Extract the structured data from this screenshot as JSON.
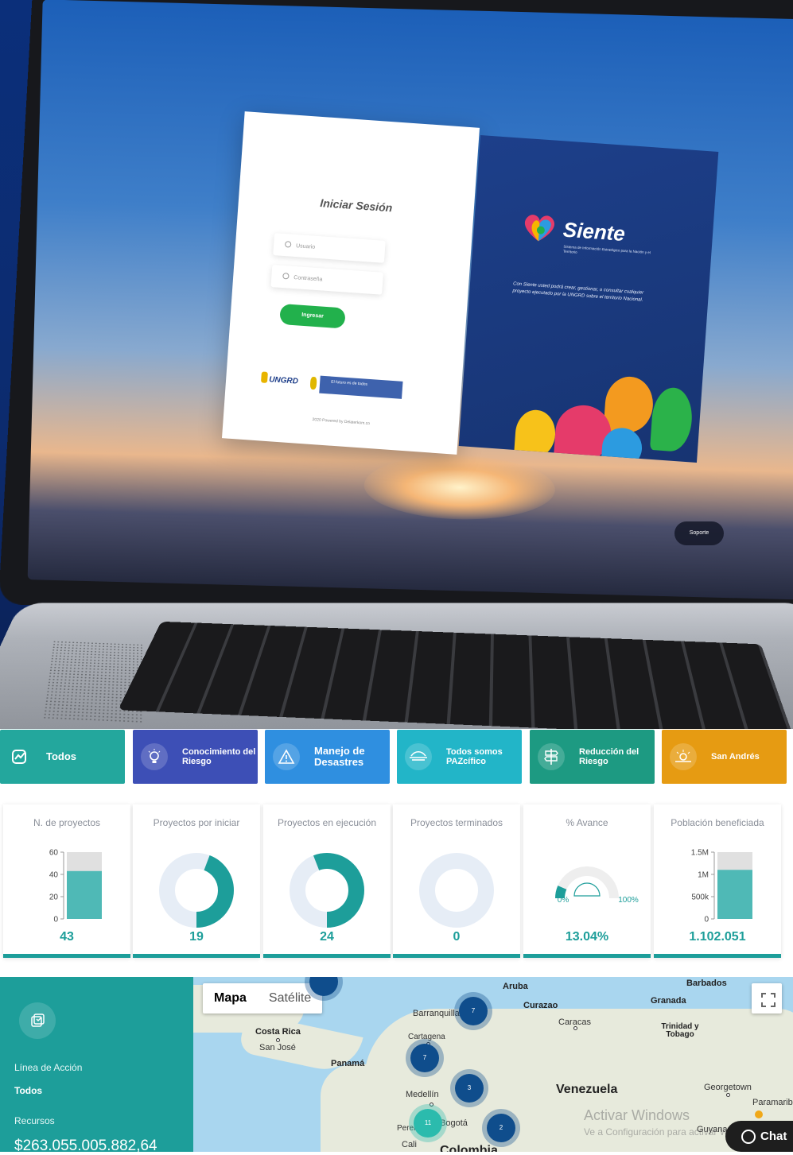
{
  "hero": {
    "login": {
      "title": "Iniciar Sesión",
      "username_placeholder": "Usuario",
      "password_placeholder": "Contraseña",
      "submit_label": "Ingresar",
      "logo_text": "UNGRD",
      "gov_logo_text": "El futuro es de todos",
      "powered_by": "2020 Powered by Delaterkom.co"
    },
    "brand": {
      "name": "Siente",
      "subtitle": "Sistema de Información Estratégico para la Nación y el Territorio",
      "description": "Con Siente usted podrá crear, gestionar, o consultar cualquier proyecto ejecutado por la UNGRD sobre el territorio Nacional."
    },
    "support_label": "Soporte"
  },
  "tabs": [
    {
      "label": "Todos",
      "color": "#23a79d",
      "icon": "chart-icon"
    },
    {
      "label": "Conocimiento del Riesgo",
      "color": "#3d4fb6",
      "icon": "lightbulb-icon"
    },
    {
      "label": "Manejo de Desastres",
      "color": "#2f8fe0",
      "icon": "warning-icon"
    },
    {
      "label": "Todos somos PAZcífico",
      "color": "#22b5c8",
      "icon": "waves-icon"
    },
    {
      "label": "Reducción del Riesgo",
      "color": "#1d9a82",
      "icon": "signpost-icon"
    },
    {
      "label": "San Andrés",
      "color": "#e69b12",
      "icon": "island-icon"
    }
  ],
  "stats": [
    {
      "title": "N. de proyectos",
      "value": "43"
    },
    {
      "title": "Proyectos por iniciar",
      "value": "19"
    },
    {
      "title": "Proyectos en ejecución",
      "value": "24"
    },
    {
      "title": "Proyectos terminados",
      "value": "0"
    },
    {
      "title": "% Avance",
      "value": "13.04%"
    },
    {
      "title": "Población beneficiada",
      "value": "1.102.051"
    }
  ],
  "chart_data": [
    {
      "type": "bar",
      "title": "N. de proyectos",
      "values": [
        43
      ],
      "ylim": [
        0,
        60
      ],
      "yticks": [
        "0",
        "20",
        "40",
        "60"
      ]
    },
    {
      "type": "pie",
      "title": "Proyectos por iniciar",
      "values": [
        19,
        24
      ],
      "colors": [
        "#1d9e9a",
        "#e6edf6"
      ]
    },
    {
      "type": "pie",
      "title": "Proyectos en ejecución",
      "values": [
        24,
        19
      ],
      "colors": [
        "#1d9e9a",
        "#e6edf6"
      ]
    },
    {
      "type": "pie",
      "title": "Proyectos terminados",
      "values": [
        0,
        43
      ],
      "colors": [
        "#1d9e9a",
        "#e6edf6"
      ]
    },
    {
      "type": "gauge",
      "title": "% Avance",
      "value": 13.04,
      "min_label": "0%",
      "max_label": "100%"
    },
    {
      "type": "bar",
      "title": "Población beneficiada",
      "values": [
        1102051
      ],
      "ylim": [
        0,
        1500000
      ],
      "yticks": [
        "0",
        "500k",
        "1M",
        "1.5M"
      ]
    }
  ],
  "sidebar": {
    "line_key": "Línea de Acción",
    "line_value": "Todos",
    "resources_key": "Recursos",
    "resources_value": "$263.055.005.882,64"
  },
  "map": {
    "type_map": "Mapa",
    "type_satellite": "Satélite",
    "places": [
      "Aruba",
      "Curazao",
      "Barbados",
      "Granada",
      "Barranquilla",
      "Caracas",
      "Trinidad y Tobago",
      "Costa Rica",
      "San José",
      "Cartagena",
      "Panamá",
      "Venezuela",
      "Georgetown",
      "Medellín",
      "Bogotá",
      "Pereira",
      "Cali",
      "Colombia",
      "Guyana",
      "Paramaribo"
    ],
    "clusters": [
      "7",
      "7",
      "3",
      "11",
      "2"
    ],
    "watermark": "Activar Windows",
    "watermark_sub": "Ve a Configuración para activar Windows."
  },
  "chat_label": "Chat"
}
